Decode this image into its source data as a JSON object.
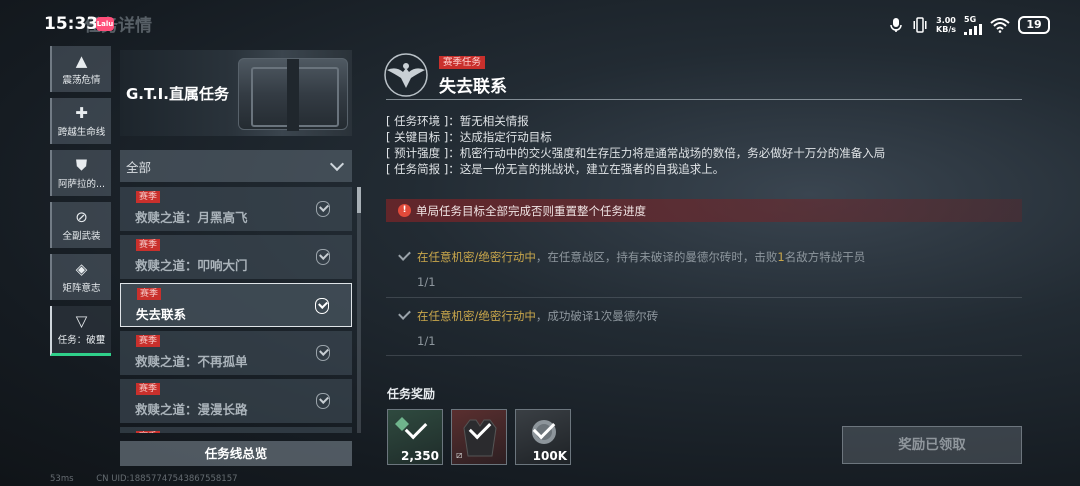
{
  "status_bar": {
    "time": "15:33",
    "app_badge": "Lalu",
    "back_title": "任务详情",
    "net_speed_value": "3.00",
    "net_speed_unit": "KB/s",
    "network": "5G",
    "battery": "19"
  },
  "rail": {
    "items": [
      {
        "label": "震荡危情",
        "icon": "▲"
      },
      {
        "label": "跨越生命线",
        "icon": "✚"
      },
      {
        "label": "阿萨拉的...",
        "icon": "⛊"
      },
      {
        "label": "全副武装",
        "icon": "⊘"
      },
      {
        "label": "矩阵意志",
        "icon": "◈"
      },
      {
        "label": "任务：破璽",
        "icon": "▽"
      }
    ]
  },
  "banner": {
    "title": "G.T.I.直属任务"
  },
  "filter": {
    "label": "全部"
  },
  "task_list": [
    {
      "tag": "赛季",
      "name": "救赎之道：月黑高飞"
    },
    {
      "tag": "赛季",
      "name": "救赎之道：叩响大门"
    },
    {
      "tag": "赛季",
      "name": "失去联系"
    },
    {
      "tag": "赛季",
      "name": "救赎之道：不再孤单"
    },
    {
      "tag": "赛季",
      "name": "救赎之道：漫漫长路"
    },
    {
      "tag": "赛季",
      "name": ""
    }
  ],
  "overview_button": "任务线总览",
  "footer": {
    "ping": "53ms",
    "uid": "CN UID:18857747543867558157"
  },
  "detail": {
    "season_tag": "赛季任务",
    "title": "失去联系",
    "info": [
      "[ 任务环境 ]：暂无相关情报",
      "[ 关键目标 ]：达成指定行动目标",
      "[ 预计强度 ]：机密行动中的交火强度和生存压力将是通常战场的数倍，务必做好十万分的准备入局",
      "[ 任务简报 ]：这是一份无言的挑战状，建立在强者的自我追求上。"
    ],
    "warning": "单局任务目标全部完成否则重置整个任务进度",
    "objectives": [
      {
        "part1": "在任意机密/绝密行动中",
        "part2": "，在任意战区，持有未破译的曼德尔砖时，击败",
        "part3": "1",
        "part4": "名敌方特战干员",
        "progress": "1/1"
      },
      {
        "part1": "在任意机密/绝密行动中",
        "part2": "，成功破译1次曼德尔砖",
        "part3": "",
        "part4": "",
        "progress": "1/1"
      }
    ],
    "rewards_title": "任务奖励",
    "rewards": [
      {
        "qty": "2,350",
        "type": "experience"
      },
      {
        "qty": "",
        "type": "armor-vest"
      },
      {
        "qty": "100K",
        "type": "currency"
      }
    ],
    "claimed_button": "奖励已领取"
  },
  "colors": {
    "accent_red": "#c9302c",
    "highlight_gold": "#c8a64b",
    "active_green": "#2fd08a"
  }
}
